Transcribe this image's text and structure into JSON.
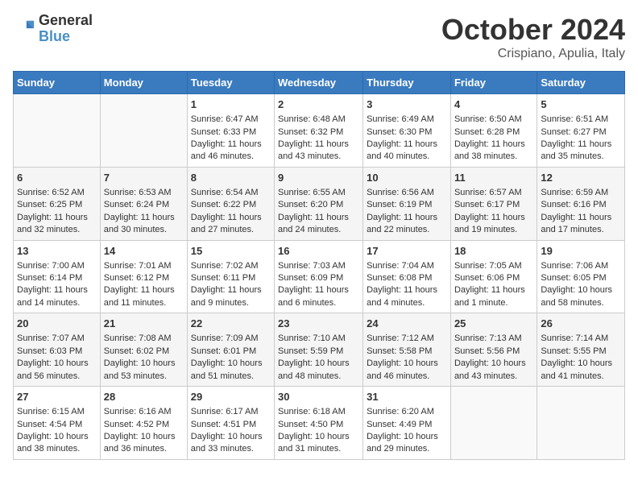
{
  "header": {
    "logo_general": "General",
    "logo_blue": "Blue",
    "month": "October 2024",
    "location": "Crispiano, Apulia, Italy"
  },
  "days_of_week": [
    "Sunday",
    "Monday",
    "Tuesday",
    "Wednesday",
    "Thursday",
    "Friday",
    "Saturday"
  ],
  "weeks": [
    [
      {
        "day": "",
        "sunrise": "",
        "sunset": "",
        "daylight": ""
      },
      {
        "day": "",
        "sunrise": "",
        "sunset": "",
        "daylight": ""
      },
      {
        "day": "1",
        "sunrise": "Sunrise: 6:47 AM",
        "sunset": "Sunset: 6:33 PM",
        "daylight": "Daylight: 11 hours and 46 minutes."
      },
      {
        "day": "2",
        "sunrise": "Sunrise: 6:48 AM",
        "sunset": "Sunset: 6:32 PM",
        "daylight": "Daylight: 11 hours and 43 minutes."
      },
      {
        "day": "3",
        "sunrise": "Sunrise: 6:49 AM",
        "sunset": "Sunset: 6:30 PM",
        "daylight": "Daylight: 11 hours and 40 minutes."
      },
      {
        "day": "4",
        "sunrise": "Sunrise: 6:50 AM",
        "sunset": "Sunset: 6:28 PM",
        "daylight": "Daylight: 11 hours and 38 minutes."
      },
      {
        "day": "5",
        "sunrise": "Sunrise: 6:51 AM",
        "sunset": "Sunset: 6:27 PM",
        "daylight": "Daylight: 11 hours and 35 minutes."
      }
    ],
    [
      {
        "day": "6",
        "sunrise": "Sunrise: 6:52 AM",
        "sunset": "Sunset: 6:25 PM",
        "daylight": "Daylight: 11 hours and 32 minutes."
      },
      {
        "day": "7",
        "sunrise": "Sunrise: 6:53 AM",
        "sunset": "Sunset: 6:24 PM",
        "daylight": "Daylight: 11 hours and 30 minutes."
      },
      {
        "day": "8",
        "sunrise": "Sunrise: 6:54 AM",
        "sunset": "Sunset: 6:22 PM",
        "daylight": "Daylight: 11 hours and 27 minutes."
      },
      {
        "day": "9",
        "sunrise": "Sunrise: 6:55 AM",
        "sunset": "Sunset: 6:20 PM",
        "daylight": "Daylight: 11 hours and 24 minutes."
      },
      {
        "day": "10",
        "sunrise": "Sunrise: 6:56 AM",
        "sunset": "Sunset: 6:19 PM",
        "daylight": "Daylight: 11 hours and 22 minutes."
      },
      {
        "day": "11",
        "sunrise": "Sunrise: 6:57 AM",
        "sunset": "Sunset: 6:17 PM",
        "daylight": "Daylight: 11 hours and 19 minutes."
      },
      {
        "day": "12",
        "sunrise": "Sunrise: 6:59 AM",
        "sunset": "Sunset: 6:16 PM",
        "daylight": "Daylight: 11 hours and 17 minutes."
      }
    ],
    [
      {
        "day": "13",
        "sunrise": "Sunrise: 7:00 AM",
        "sunset": "Sunset: 6:14 PM",
        "daylight": "Daylight: 11 hours and 14 minutes."
      },
      {
        "day": "14",
        "sunrise": "Sunrise: 7:01 AM",
        "sunset": "Sunset: 6:12 PM",
        "daylight": "Daylight: 11 hours and 11 minutes."
      },
      {
        "day": "15",
        "sunrise": "Sunrise: 7:02 AM",
        "sunset": "Sunset: 6:11 PM",
        "daylight": "Daylight: 11 hours and 9 minutes."
      },
      {
        "day": "16",
        "sunrise": "Sunrise: 7:03 AM",
        "sunset": "Sunset: 6:09 PM",
        "daylight": "Daylight: 11 hours and 6 minutes."
      },
      {
        "day": "17",
        "sunrise": "Sunrise: 7:04 AM",
        "sunset": "Sunset: 6:08 PM",
        "daylight": "Daylight: 11 hours and 4 minutes."
      },
      {
        "day": "18",
        "sunrise": "Sunrise: 7:05 AM",
        "sunset": "Sunset: 6:06 PM",
        "daylight": "Daylight: 11 hours and 1 minute."
      },
      {
        "day": "19",
        "sunrise": "Sunrise: 7:06 AM",
        "sunset": "Sunset: 6:05 PM",
        "daylight": "Daylight: 10 hours and 58 minutes."
      }
    ],
    [
      {
        "day": "20",
        "sunrise": "Sunrise: 7:07 AM",
        "sunset": "Sunset: 6:03 PM",
        "daylight": "Daylight: 10 hours and 56 minutes."
      },
      {
        "day": "21",
        "sunrise": "Sunrise: 7:08 AM",
        "sunset": "Sunset: 6:02 PM",
        "daylight": "Daylight: 10 hours and 53 minutes."
      },
      {
        "day": "22",
        "sunrise": "Sunrise: 7:09 AM",
        "sunset": "Sunset: 6:01 PM",
        "daylight": "Daylight: 10 hours and 51 minutes."
      },
      {
        "day": "23",
        "sunrise": "Sunrise: 7:10 AM",
        "sunset": "Sunset: 5:59 PM",
        "daylight": "Daylight: 10 hours and 48 minutes."
      },
      {
        "day": "24",
        "sunrise": "Sunrise: 7:12 AM",
        "sunset": "Sunset: 5:58 PM",
        "daylight": "Daylight: 10 hours and 46 minutes."
      },
      {
        "day": "25",
        "sunrise": "Sunrise: 7:13 AM",
        "sunset": "Sunset: 5:56 PM",
        "daylight": "Daylight: 10 hours and 43 minutes."
      },
      {
        "day": "26",
        "sunrise": "Sunrise: 7:14 AM",
        "sunset": "Sunset: 5:55 PM",
        "daylight": "Daylight: 10 hours and 41 minutes."
      }
    ],
    [
      {
        "day": "27",
        "sunrise": "Sunrise: 6:15 AM",
        "sunset": "Sunset: 4:54 PM",
        "daylight": "Daylight: 10 hours and 38 minutes."
      },
      {
        "day": "28",
        "sunrise": "Sunrise: 6:16 AM",
        "sunset": "Sunset: 4:52 PM",
        "daylight": "Daylight: 10 hours and 36 minutes."
      },
      {
        "day": "29",
        "sunrise": "Sunrise: 6:17 AM",
        "sunset": "Sunset: 4:51 PM",
        "daylight": "Daylight: 10 hours and 33 minutes."
      },
      {
        "day": "30",
        "sunrise": "Sunrise: 6:18 AM",
        "sunset": "Sunset: 4:50 PM",
        "daylight": "Daylight: 10 hours and 31 minutes."
      },
      {
        "day": "31",
        "sunrise": "Sunrise: 6:20 AM",
        "sunset": "Sunset: 4:49 PM",
        "daylight": "Daylight: 10 hours and 29 minutes."
      },
      {
        "day": "",
        "sunrise": "",
        "sunset": "",
        "daylight": ""
      },
      {
        "day": "",
        "sunrise": "",
        "sunset": "",
        "daylight": ""
      }
    ]
  ]
}
